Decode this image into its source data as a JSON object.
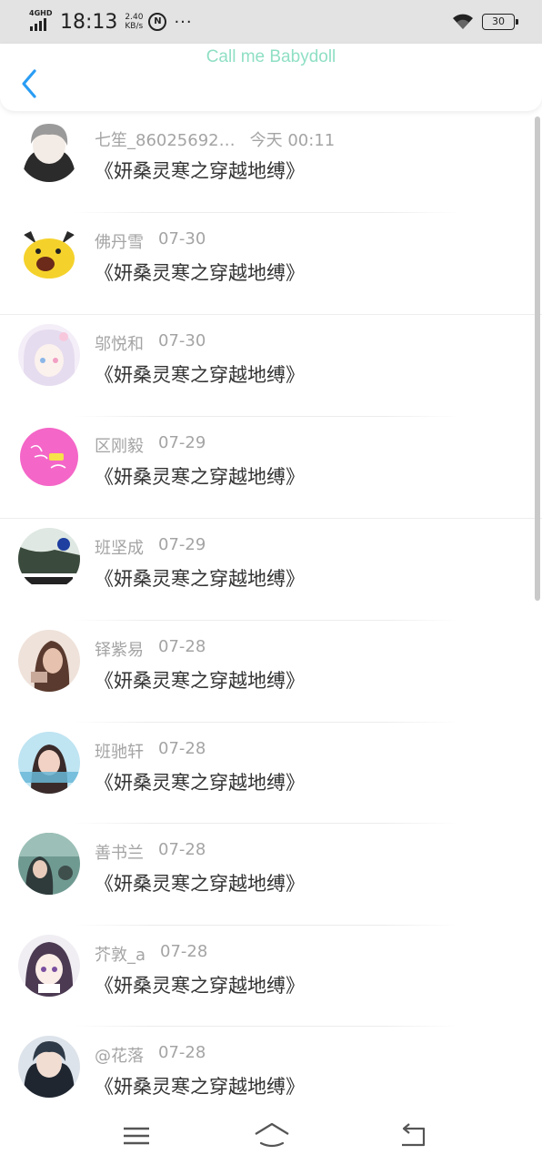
{
  "status_bar": {
    "network": "4GHD",
    "time": "18:13",
    "speed_value": "2.40",
    "speed_unit": "KB/s",
    "circle_label": "N",
    "dots": "···",
    "battery": "30"
  },
  "header": {
    "title": "Call me Babydoll"
  },
  "messages": [
    {
      "name": "七笙_86025692…",
      "time": "今天 00:11",
      "text": "《妍桑灵寒之穿越地缚》",
      "avatar_color": "#5a5a5a",
      "avatar_icon": "avatar-anime-boy"
    },
    {
      "name": "佛丹雪",
      "time": "07-30",
      "text": "《妍桑灵寒之穿越地缚》",
      "avatar_color": "#f5d22b",
      "avatar_icon": "avatar-yellow-meme"
    },
    {
      "name": "邬悦和",
      "time": "07-30",
      "text": "《妍桑灵寒之穿越地缚》",
      "avatar_color": "#eae4f2",
      "avatar_icon": "avatar-anime-girl"
    },
    {
      "name": "区刚毅",
      "time": "07-29",
      "text": "《妍桑灵寒之穿越地缚》",
      "avatar_color": "#f466c8",
      "avatar_icon": "avatar-pink-text"
    },
    {
      "name": "班坚成",
      "time": "07-29",
      "text": "《妍桑灵寒之穿越地缚》",
      "avatar_color": "#3a4a3c",
      "avatar_icon": "avatar-photo"
    },
    {
      "name": "铎紫易",
      "time": "07-28",
      "text": "《妍桑灵寒之穿越地缚》",
      "avatar_color": "#c9a99a",
      "avatar_icon": "avatar-photo"
    },
    {
      "name": "班驰轩",
      "time": "07-28",
      "text": "《妍桑灵寒之穿越地缚》",
      "avatar_color": "#6ab9d8",
      "avatar_icon": "avatar-photo"
    },
    {
      "name": "善书兰",
      "time": "07-28",
      "text": "《妍桑灵寒之穿越地缚》",
      "avatar_color": "#3f6f6a",
      "avatar_icon": "avatar-photo"
    },
    {
      "name": "芥敦_a",
      "time": "07-28",
      "text": "《妍桑灵寒之穿越地缚》",
      "avatar_color": "#6c5a7a",
      "avatar_icon": "avatar-anime-girl"
    },
    {
      "name": "@花落",
      "time": "07-28",
      "text": "《妍桑灵寒之穿越地缚》",
      "avatar_color": "#2f3a48",
      "avatar_icon": "avatar-anime-boy"
    }
  ],
  "colors": {
    "title": "#8fdfc5",
    "back_arrow": "#2a9df4",
    "meta_text": "#a4a4a4",
    "message_text": "#333333"
  }
}
